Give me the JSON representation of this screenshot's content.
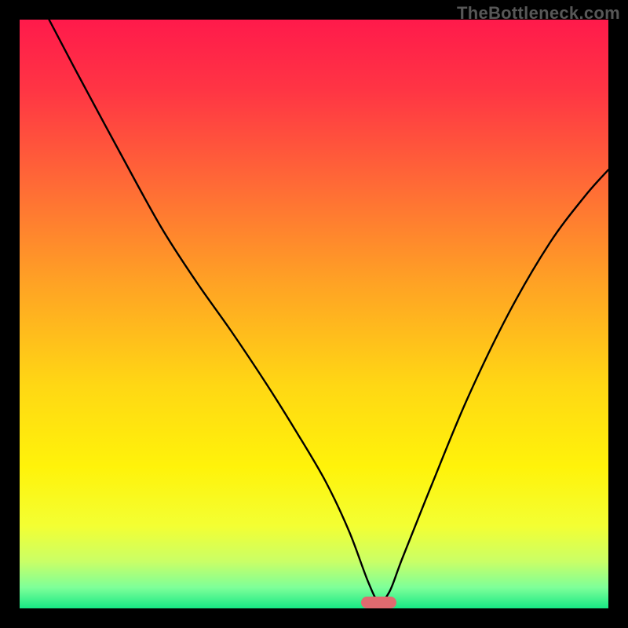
{
  "watermark": "TheBottleneck.com",
  "chart_data": {
    "type": "line",
    "title": "",
    "xlabel": "",
    "ylabel": "",
    "xlim": [
      0,
      1
    ],
    "ylim": [
      0,
      1
    ],
    "background_gradient": {
      "stops": [
        {
          "offset": 0.0,
          "color": "#ff1a4b"
        },
        {
          "offset": 0.12,
          "color": "#ff3544"
        },
        {
          "offset": 0.28,
          "color": "#ff6a36"
        },
        {
          "offset": 0.45,
          "color": "#ffa324"
        },
        {
          "offset": 0.62,
          "color": "#ffd714"
        },
        {
          "offset": 0.76,
          "color": "#fff30a"
        },
        {
          "offset": 0.86,
          "color": "#f3ff33"
        },
        {
          "offset": 0.92,
          "color": "#caff66"
        },
        {
          "offset": 0.965,
          "color": "#7dff99"
        },
        {
          "offset": 1.0,
          "color": "#17e884"
        }
      ]
    },
    "series": [
      {
        "name": "bottleneck-curve",
        "x": [
          0.05,
          0.1,
          0.17,
          0.24,
          0.3,
          0.36,
          0.42,
          0.47,
          0.52,
          0.56,
          0.592,
          0.61,
          0.628,
          0.65,
          0.7,
          0.76,
          0.83,
          0.9,
          0.96,
          1.0
        ],
        "y": [
          1.0,
          0.905,
          0.775,
          0.648,
          0.555,
          0.47,
          0.38,
          0.3,
          0.215,
          0.13,
          0.045,
          0.012,
          0.028,
          0.085,
          0.21,
          0.355,
          0.5,
          0.62,
          0.7,
          0.745
        ]
      }
    ],
    "marker": {
      "name": "optimal-range",
      "x_center": 0.61,
      "y": 0.0,
      "width": 0.06,
      "height": 0.02,
      "color": "#e06a6f"
    }
  }
}
